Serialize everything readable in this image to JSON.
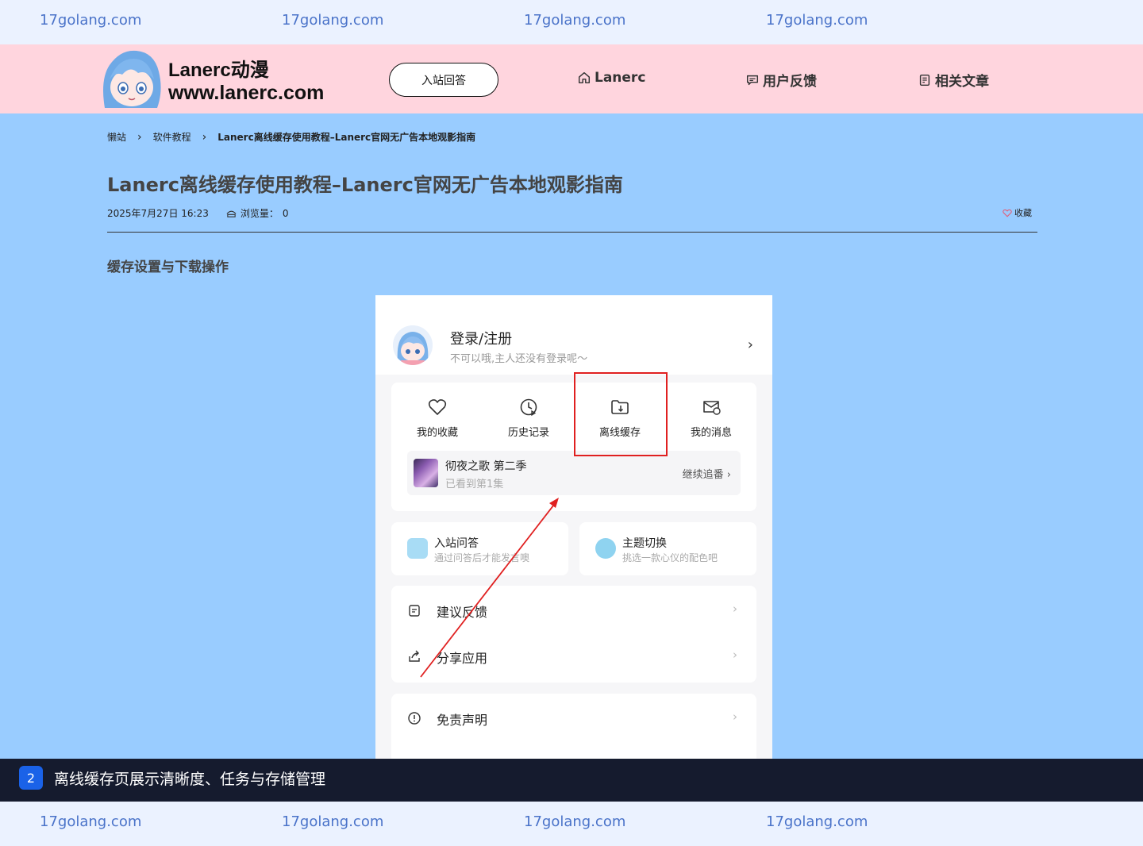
{
  "watermark": {
    "text": "17golang.com"
  },
  "header": {
    "site_name": "Lanerc动漫",
    "site_url": "www.lanerc.com",
    "qa_button": "入站回答",
    "nav": [
      {
        "label": "Lanerc",
        "icon": "home-icon"
      },
      {
        "label": "用户反馈",
        "icon": "chat-icon"
      },
      {
        "label": "相关文章",
        "icon": "document-icon"
      }
    ]
  },
  "breadcrumb": [
    "懒站",
    "软件教程",
    "Lanerc离线缓存使用教程–Lanerc官网无广告本地观影指南"
  ],
  "article": {
    "title": "Lanerc离线缓存使用教程–Lanerc官网无广告本地观影指南",
    "date": "2025年7月27日 16:23",
    "views_label": "浏览量：",
    "views_value": "0",
    "favorite_label": "收藏",
    "section_heading": "缓存设置与下载操作"
  },
  "screenshot": {
    "login_title": "登录/注册",
    "login_subtitle": "不可以哦,主人还没有登录呢～",
    "quick_actions": [
      {
        "label": "我的收藏",
        "icon": "heart-icon"
      },
      {
        "label": "历史记录",
        "icon": "history-icon"
      },
      {
        "label": "离线缓存",
        "icon": "folder-download-icon"
      },
      {
        "label": "我的消息",
        "icon": "message-icon"
      }
    ],
    "continue_watching": {
      "title": "彻夜之歌 第二季",
      "progress": "已看到第1集",
      "button": "继续追番"
    },
    "features": [
      {
        "title": "入站问答",
        "subtitle": "通过问答后才能发言噢",
        "color": "#a8dcf5"
      },
      {
        "title": "主题切换",
        "subtitle": "挑选一款心仪的配色吧",
        "color": "#8fd3f0"
      }
    ],
    "menu": [
      {
        "label": "建议反馈",
        "icon": "clipboard-icon"
      },
      {
        "label": "分享应用",
        "icon": "share-icon"
      },
      {
        "label": "免责声明",
        "icon": "info-icon"
      }
    ],
    "highlight_color": "#e02020"
  },
  "caption": {
    "number": "2",
    "text": "离线缓存页展示清晰度、任务与存储管理"
  }
}
